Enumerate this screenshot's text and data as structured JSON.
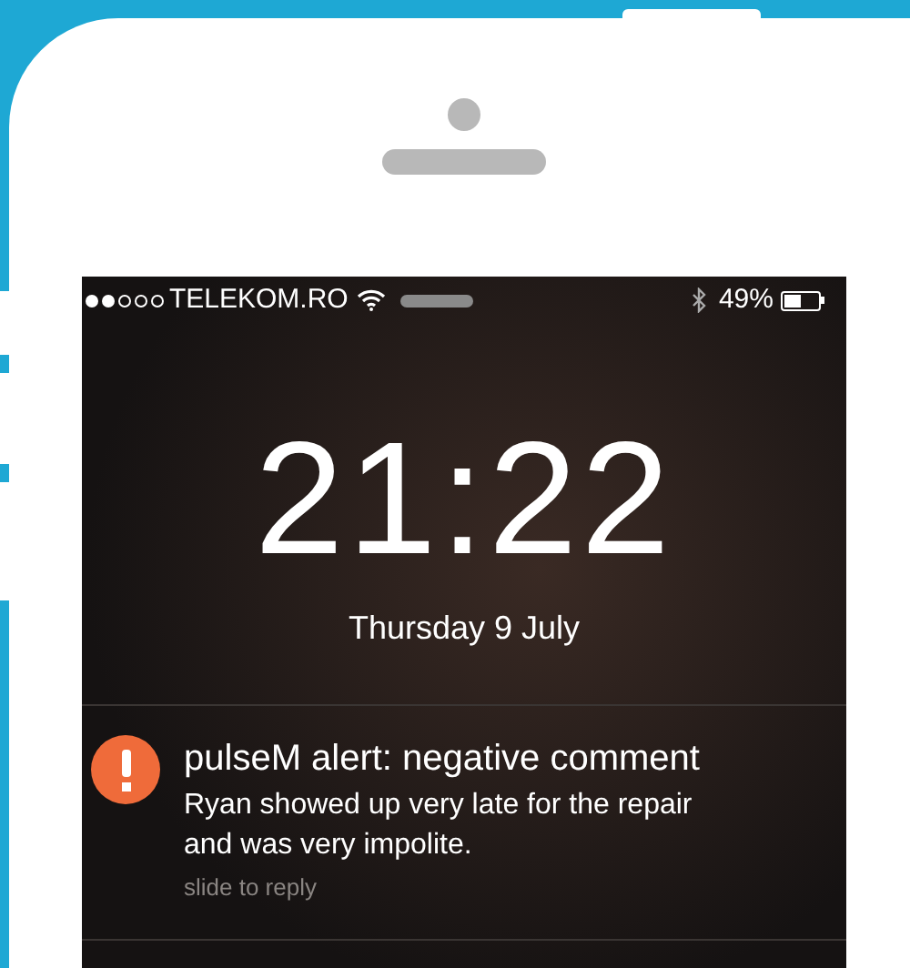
{
  "status_bar": {
    "carrier": "TELEKOM.RO",
    "battery_percent": "49%"
  },
  "lock_screen": {
    "time": "21:22",
    "date": "Thursday 9 July"
  },
  "notification": {
    "title": "pulseM alert: negative comment",
    "body": "Ryan showed up very late for the repair and was very impolite.",
    "hint": "slide to reply"
  }
}
